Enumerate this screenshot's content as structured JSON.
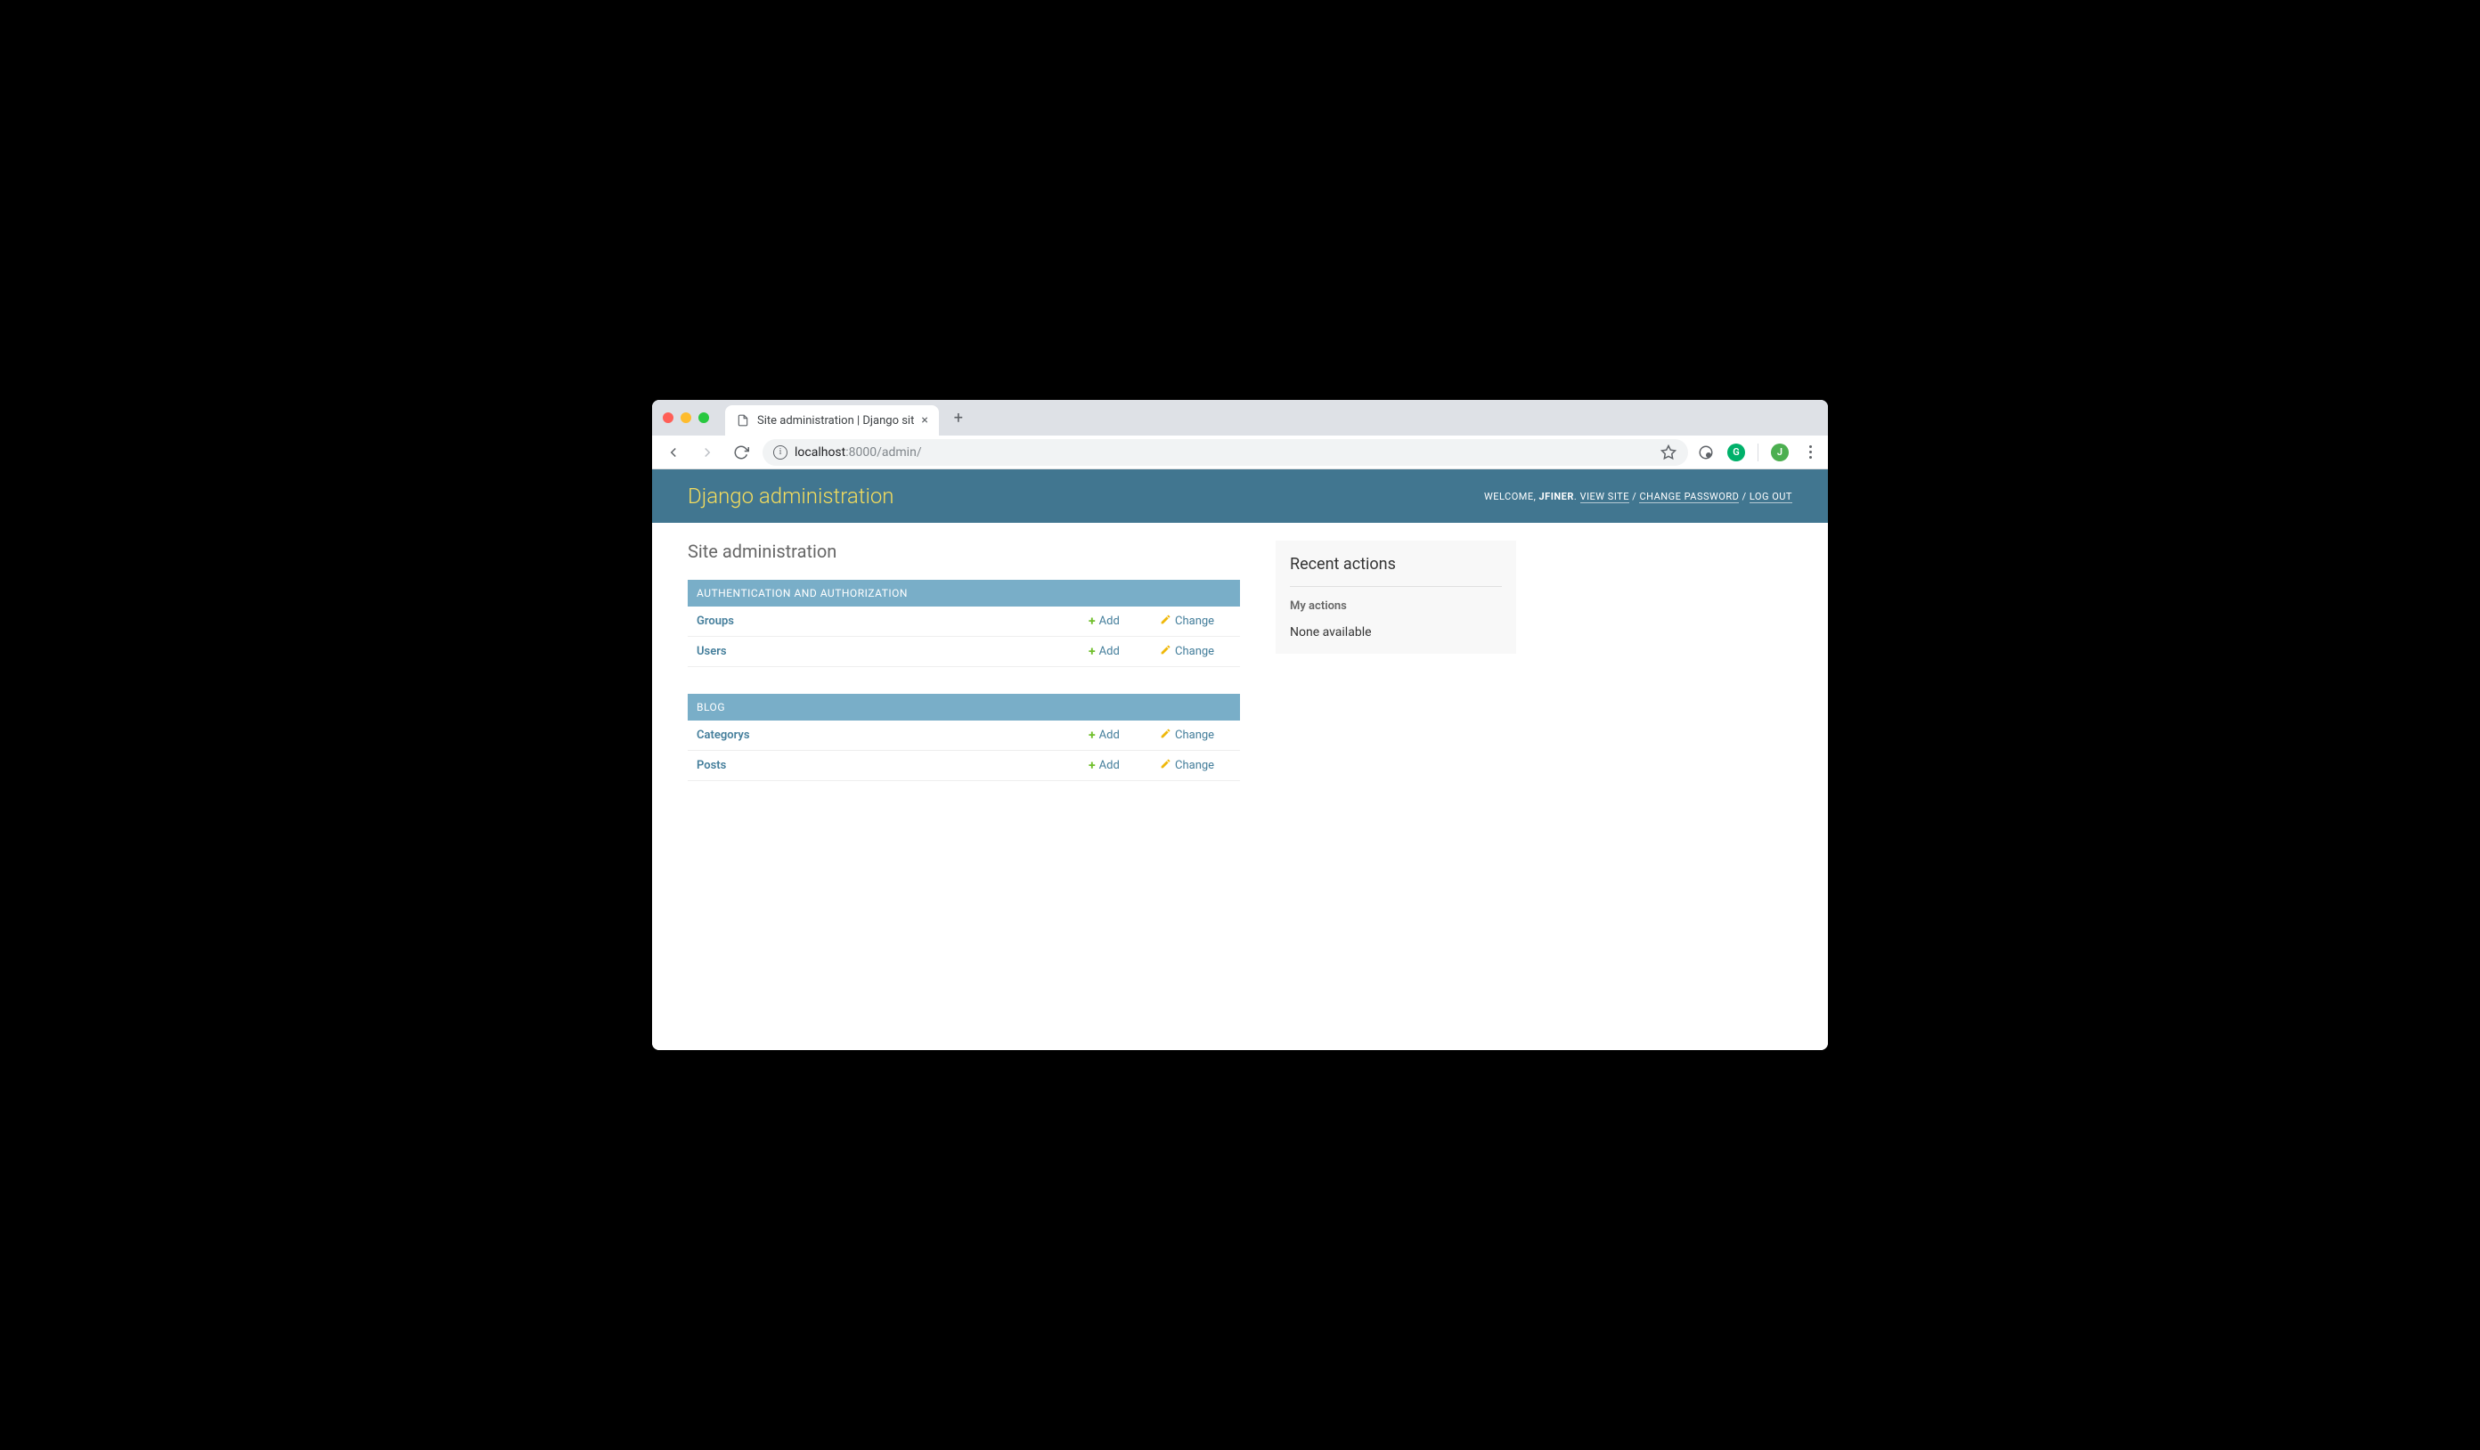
{
  "browser": {
    "tab_title": "Site administration | Django sit",
    "url_host": "localhost",
    "url_port_path": ":8000/admin/",
    "avatar_letter": "J"
  },
  "header": {
    "branding": "Django administration",
    "welcome": "WELCOME, ",
    "username": "JFINER",
    "view_site": "VIEW SITE",
    "change_password": "CHANGE PASSWORD",
    "log_out": "LOG OUT"
  },
  "page": {
    "title": "Site administration"
  },
  "modules": [
    {
      "caption": "AUTHENTICATION AND AUTHORIZATION",
      "models": [
        {
          "name": "Groups",
          "add": "Add",
          "change": "Change"
        },
        {
          "name": "Users",
          "add": "Add",
          "change": "Change"
        }
      ]
    },
    {
      "caption": "BLOG",
      "models": [
        {
          "name": "Categorys",
          "add": "Add",
          "change": "Change"
        },
        {
          "name": "Posts",
          "add": "Add",
          "change": "Change"
        }
      ]
    }
  ],
  "sidebar": {
    "title": "Recent actions",
    "subtitle": "My actions",
    "empty": "None available"
  }
}
